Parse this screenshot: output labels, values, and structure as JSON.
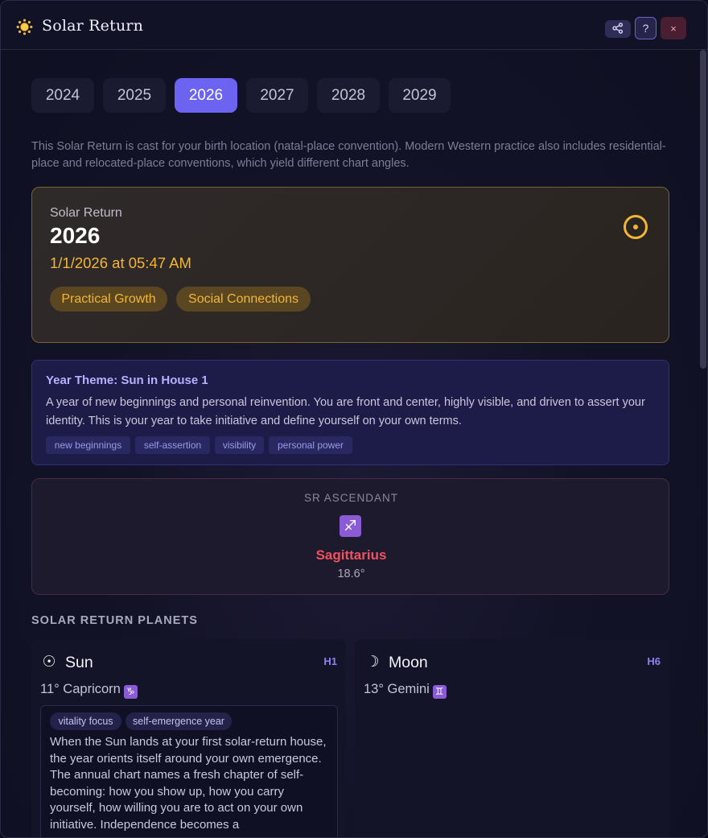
{
  "window": {
    "title": "Solar Return",
    "title_icon": "sun-emoji",
    "buttons": {
      "share": "share-icon",
      "help": "?",
      "close": "×"
    }
  },
  "tabs": [
    {
      "label": "2024",
      "active": false
    },
    {
      "label": "2025",
      "active": false
    },
    {
      "label": "2026",
      "active": true
    },
    {
      "label": "2027",
      "active": false
    },
    {
      "label": "2028",
      "active": false
    },
    {
      "label": "2029",
      "active": false
    }
  ],
  "note": "This Solar Return is cast for your birth location (natal-place convention). Modern Western practice also includes residential-place and relocated-place conventions, which yield different chart angles.",
  "solar_return": {
    "label": "Solar Return",
    "year": "2026",
    "datetime": "1/1/2026 at 05:47 AM",
    "themes": [
      "Practical Growth",
      "Social Connections"
    ],
    "accent": "#f3b634"
  },
  "year_theme": {
    "title": "Year Theme: Sun in House 1",
    "body": "A year of new beginnings and personal reinvention. You are front and center, highly visible, and driven to assert your identity. This is your year to take initiative and define yourself on your own terms.",
    "tags": [
      "new beginnings",
      "self-assertion",
      "visibility",
      "personal power"
    ]
  },
  "ascendant": {
    "label": "SR ASCENDANT",
    "glyph": "♐",
    "sign": "Sagittarius",
    "degree": "18.6°",
    "color": "#f0525f"
  },
  "planets_section": {
    "title": "SOLAR RETURN PLANETS",
    "planets": [
      {
        "icon": "☉",
        "name": "Sun",
        "house": "H1",
        "position": "11° Capricorn",
        "sign_glyph": "♑",
        "tags": [
          "vitality focus",
          "self-emergence year"
        ],
        "body": "When the Sun lands at your first solar-return house, the year orients itself around your own emergence. The annual chart names a fresh chapter of self-becoming: how you show up, how you carry yourself, how willing you are to act on your own initiative. Independence becomes a"
      },
      {
        "icon": "☽",
        "name": "Moon",
        "house": "H6",
        "position": "13° Gemini",
        "sign_glyph": "♊"
      }
    ]
  }
}
